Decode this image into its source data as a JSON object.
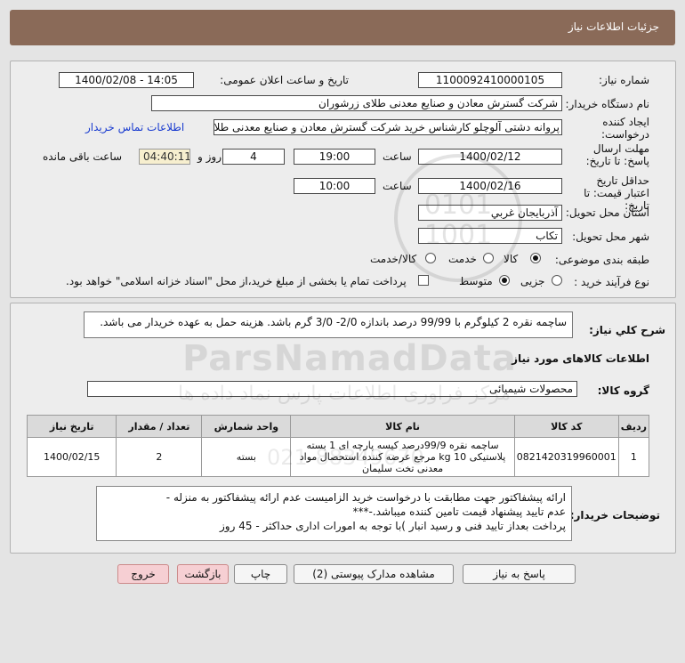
{
  "header": {
    "title": "جزئیات اطلاعات نیاز"
  },
  "fields": {
    "need_number_label": "شماره نیاز:",
    "need_number": "1100092410000105",
    "announce_label": "تاریخ و ساعت اعلان عمومی:",
    "announce_value": "1400/02/08 - 14:05",
    "buyer_org_label": "نام دستگاه خریدار:",
    "buyer_org": "شرکت گسترش معادن و صنایع معدنی طلای زرشوران",
    "requester_label": "ایجاد کننده درخواست:",
    "requester": "پروانه  دشتی آلوچلو کارشناس خرید شرکت گسترش معادن و صنایع معدنی طلای زرشوران",
    "contact_link": "اطلاعات تماس خریدار",
    "deadline_label": "مهلت ارسال پاسخ: تا تاریخ:",
    "deadline_date": "1400/02/12",
    "time_label": "ساعت",
    "deadline_time": "19:00",
    "days_value": "4",
    "days_label": "روز و",
    "remaining_time": "04:40:11",
    "remaining_label": "ساعت باقی مانده",
    "validity_label": "حداقل تاریخ اعتبار قیمت: تا تاریخ:",
    "validity_date": "1400/02/16",
    "validity_time_label": "ساعت",
    "validity_time": "10:00",
    "province_label": "استان محل تحویل:",
    "province": "آذربایجان غربي",
    "city_label": "شهر محل تحویل:",
    "city": "تکاب",
    "category_label": "طبقه بندی موضوعی:",
    "category_options": [
      "کالا",
      "خدمت",
      "کالا/خدمت"
    ],
    "process_label": "نوع فرآیند خرید :",
    "process_options": [
      "جزیی",
      "متوسط"
    ],
    "payment_note": "پرداخت تمام یا بخشی از مبلغ خرید،از محل \"اسناد خزانه اسلامی\" خواهد بود."
  },
  "description": {
    "label": "شرح کلي نياز:",
    "text": "ساچمه نقره 2 کیلوگرم با 99/99 درصد  باندازه 2/0- 3/0 گرم باشد. هزینه حمل به عهده خریدار می باشد."
  },
  "goods": {
    "section_title": "اطلاعات کالاهای مورد نیاز",
    "group_label": "گروه کالا:",
    "group_value": "محصولات شیمیائی",
    "table": {
      "headers": [
        "ردیف",
        "کد کالا",
        "نام کالا",
        "واحد شمارش",
        "تعداد / مقدار",
        "تاریخ نیاز"
      ],
      "rows": [
        {
          "row": "1",
          "code": "0821420319960001",
          "name": "ساچمه نقره 99/9درصد کیسه پارچه ای 1 بسته پلاستیکی 10 kg مرجع عرضه کننده استحصال مواد معدنی تخت سلیمان",
          "unit": "بسته",
          "qty": "2",
          "date": "1400/02/15"
        }
      ]
    }
  },
  "buyer_notes": {
    "label": "توضیحات خریدار:",
    "lines": [
      "ارائه پیشفاکتور جهت مطابقت با درخواست خرید الزامیست عدم ارائه پیشفاکتور به منزله -",
      "عدم تایید پیشنهاد قیمت تامین کننده میباشد.-***",
      "پرداخت بعداز تایید فنی و رسید انبار )با توجه به امورات اداری حداکثر - 45 روز"
    ]
  },
  "buttons": {
    "reply": "پاسخ به نیاز",
    "attachments": "مشاهده مدارک پیوستی (2)",
    "print": "چاپ",
    "back": "بازگشت",
    "exit": "خروج"
  },
  "watermark": {
    "brand": "ParsNamadData",
    "persian": "مرکز فراوری اطلاعات پارس نماد داده ها",
    "phone": "021-88349670"
  },
  "colors": {
    "header_bg": "#8a6a58",
    "link": "#1a3cd0",
    "timer_bg": "#f7efcf",
    "danger_button": "#f6cfd3"
  }
}
